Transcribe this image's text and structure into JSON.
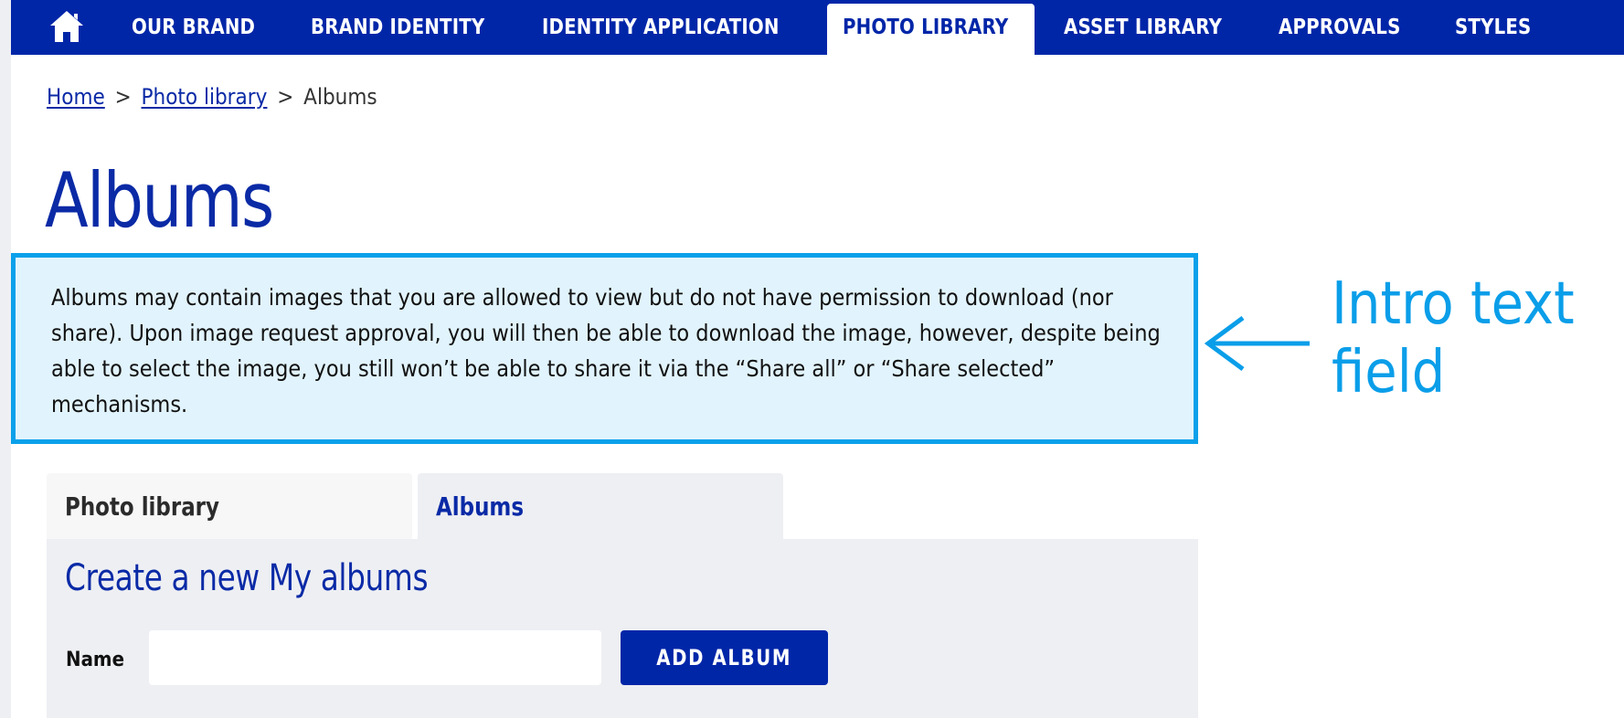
{
  "nav": {
    "home_icon": "home-icon",
    "items": [
      {
        "label": "OUR BRAND",
        "active": false
      },
      {
        "label": "BRAND IDENTITY",
        "active": false
      },
      {
        "label": "IDENTITY APPLICATION",
        "active": false
      },
      {
        "label": "PHOTO LIBRARY",
        "active": true
      },
      {
        "label": "ASSET LIBRARY",
        "active": false
      },
      {
        "label": "APPROVALS",
        "active": false
      },
      {
        "label": "STYLES",
        "active": false
      }
    ]
  },
  "breadcrumb": {
    "items": [
      {
        "label": "Home",
        "link": true
      },
      {
        "label": "Photo library",
        "link": true
      },
      {
        "label": "Albums",
        "link": false
      }
    ],
    "separator": ">"
  },
  "page": {
    "title": "Albums",
    "intro_text": "Albums may contain images that you are allowed to view but do not have permission to download (nor share). Upon image request approval, you will then be able to download the image, however, despite being able to select the image, you still won’t be able to share it via the “Share all” or “Share selected” mechanisms."
  },
  "annotation": {
    "label": "Intro text field",
    "arrow_icon": "arrow-left-icon"
  },
  "tabs": [
    {
      "label": "Photo library",
      "active": false
    },
    {
      "label": "Albums",
      "active": true
    }
  ],
  "create_album": {
    "heading": "Create a new My albums",
    "name_label": "Name",
    "name_value": "",
    "name_placeholder": "",
    "button_label": "ADD ALBUM"
  },
  "colors": {
    "brand_blue": "#0026a8",
    "annotation_blue": "#0a9ee9",
    "intro_bg": "#e1f3fc",
    "panel_bg": "#eeeff3"
  }
}
